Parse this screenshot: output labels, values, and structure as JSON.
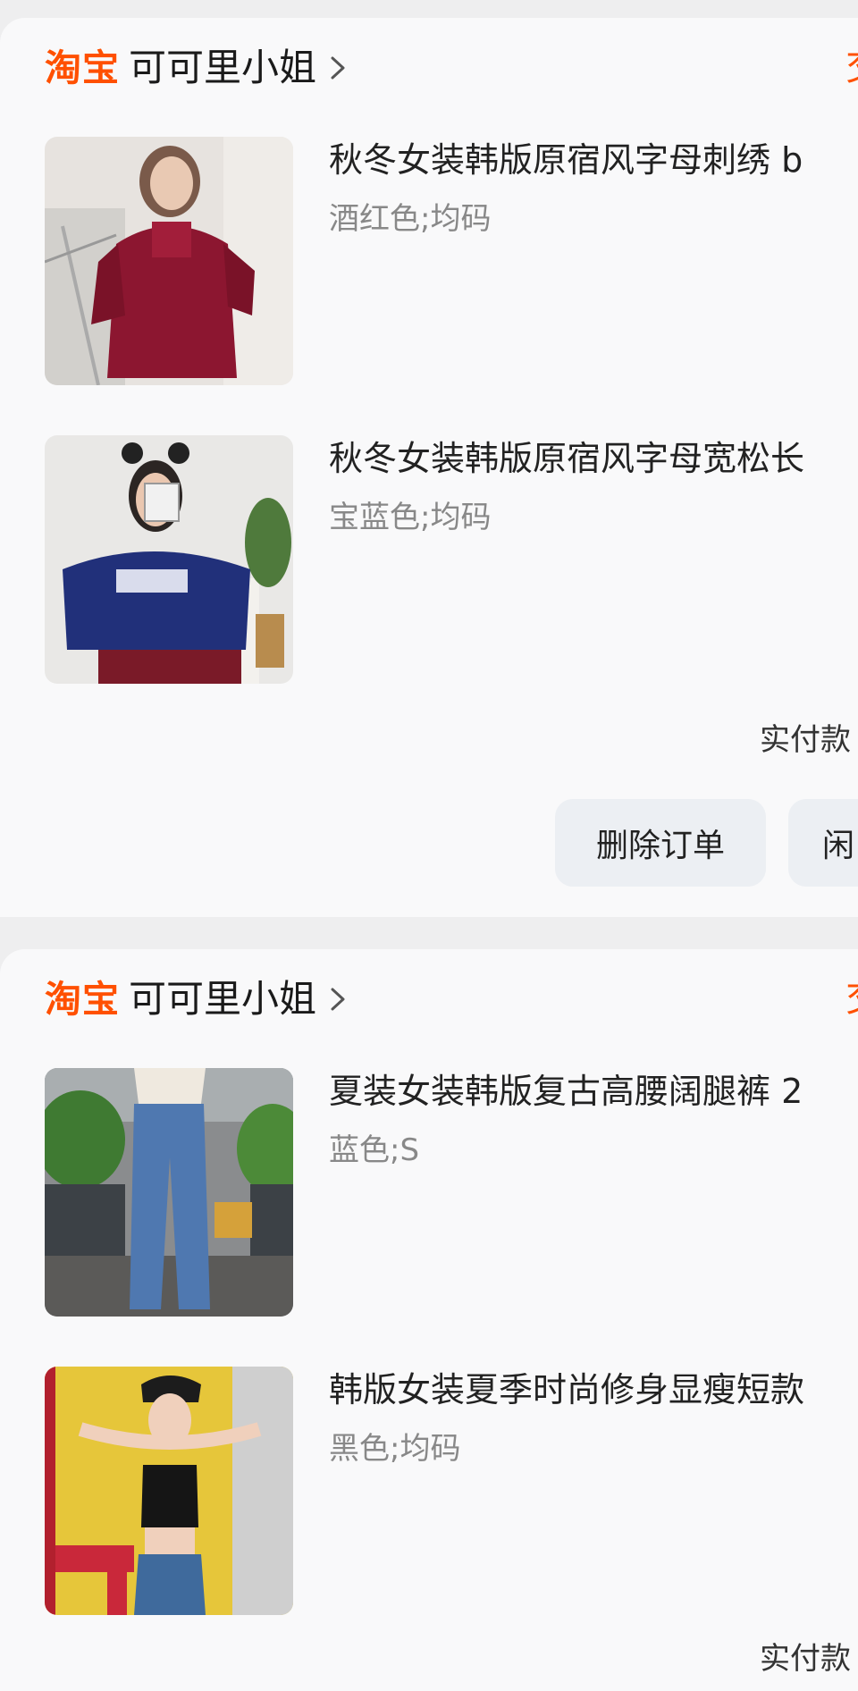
{
  "orders": [
    {
      "platform_logo": "淘宝",
      "shop_name": "可可里小姐",
      "status_fragment": "交",
      "items": [
        {
          "title": "秋冬女装韩版原宿风字母刺绣 b",
          "spec": "酒红色;均码",
          "image": "model in wine-red velvet hoodie"
        },
        {
          "title": "秋冬女装韩版原宿风字母宽松长",
          "spec": "宝蓝色;均码",
          "image": "model in royal-blue sweatshirt with VIOLENCE print"
        }
      ],
      "paid_label": "实付款",
      "buttons": {
        "delete": "删除订单",
        "idle": "闲"
      }
    },
    {
      "platform_logo": "淘宝",
      "shop_name": "可可里小姐",
      "status_fragment": "交",
      "items": [
        {
          "title": "夏装女装韩版复古高腰阔腿裤 2",
          "spec": "蓝色;S",
          "image": "model in high-waist wide-leg jeans"
        },
        {
          "title": "韩版女装夏季时尚修身显瘦短款",
          "spec": "黑色;均码",
          "image": "model in black crop top and cap"
        }
      ],
      "paid_label": "实付款"
    }
  ],
  "colors": {
    "brand": "#ff5000",
    "page_bg": "#eeeeef",
    "card_bg": "#f9f9fa",
    "button_bg": "#eceff3"
  }
}
